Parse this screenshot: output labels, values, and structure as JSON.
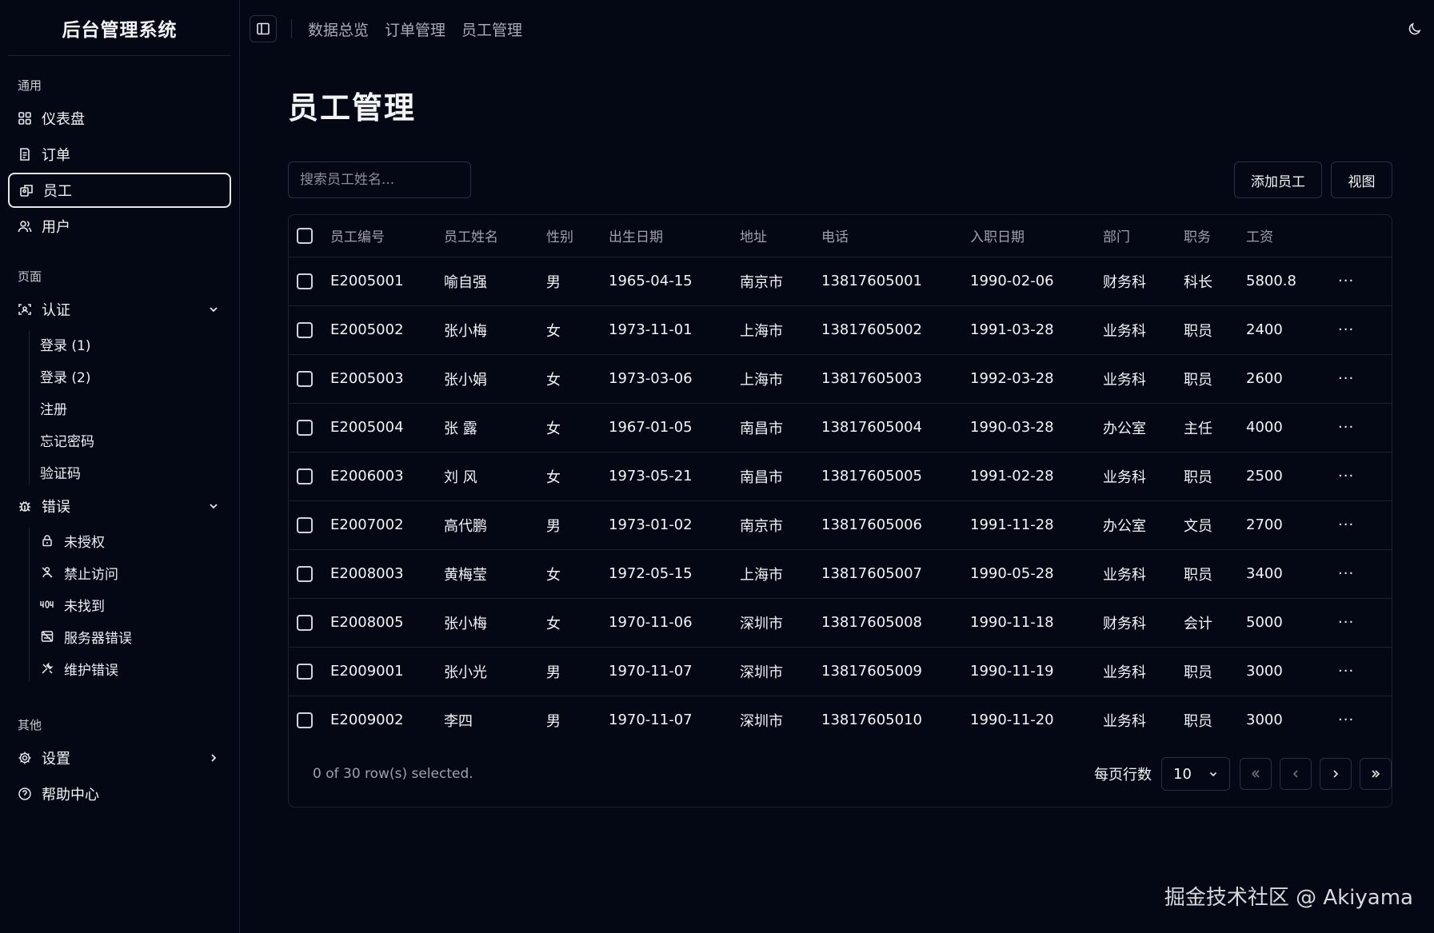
{
  "sidebar": {
    "brand": "后台管理系统",
    "sections": [
      {
        "label": "通用",
        "items": [
          {
            "label": "仪表盘",
            "icon": "dashboard-icon"
          },
          {
            "label": "订单",
            "icon": "order-icon"
          },
          {
            "label": "员工",
            "icon": "employee-icon",
            "active": true
          },
          {
            "label": "用户",
            "icon": "users-icon"
          }
        ]
      },
      {
        "label": "页面",
        "auth": {
          "label": "认证",
          "icon": "auth-icon",
          "children": [
            "登录 (1)",
            "登录 (2)",
            "注册",
            "忘记密码",
            "验证码"
          ]
        },
        "errors": {
          "label": "错误",
          "icon": "bug-icon",
          "children": [
            {
              "label": "未授权",
              "icon": "lock-icon"
            },
            {
              "label": "禁止访问",
              "icon": "forbidden-icon"
            },
            {
              "label": "未找到",
              "icon": "not-found-icon"
            },
            {
              "label": "服务器错误",
              "icon": "server-error-icon"
            },
            {
              "label": "维护错误",
              "icon": "maintenance-icon"
            }
          ]
        }
      },
      {
        "label": "其他",
        "items": [
          {
            "label": "设置",
            "icon": "settings-icon"
          },
          {
            "label": "帮助中心",
            "icon": "help-icon"
          }
        ]
      }
    ]
  },
  "topbar": {
    "links": [
      "数据总览",
      "订单管理",
      "员工管理"
    ]
  },
  "page": {
    "title": "员工管理",
    "search_placeholder": "搜索员工姓名...",
    "add_button": "添加员工",
    "view_button": "视图"
  },
  "table": {
    "columns": [
      "员工编号",
      "员工姓名",
      "性别",
      "出生日期",
      "地址",
      "电话",
      "入职日期",
      "部门",
      "职务",
      "工资"
    ],
    "rows": [
      [
        "E2005001",
        "喻自强",
        "男",
        "1965-04-15",
        "南京市",
        "13817605001",
        "1990-02-06",
        "财务科",
        "科长",
        "5800.8"
      ],
      [
        "E2005002",
        "张小梅",
        "女",
        "1973-11-01",
        "上海市",
        "13817605002",
        "1991-03-28",
        "业务科",
        "职员",
        "2400"
      ],
      [
        "E2005003",
        "张小娟",
        "女",
        "1973-03-06",
        "上海市",
        "13817605003",
        "1992-03-28",
        "业务科",
        "职员",
        "2600"
      ],
      [
        "E2005004",
        "张 露",
        "女",
        "1967-01-05",
        "南昌市",
        "13817605004",
        "1990-03-28",
        "办公室",
        "主任",
        "4000"
      ],
      [
        "E2006003",
        "刘 风",
        "女",
        "1973-05-21",
        "南昌市",
        "13817605005",
        "1991-02-28",
        "业务科",
        "职员",
        "2500"
      ],
      [
        "E2007002",
        "高代鹏",
        "男",
        "1973-01-02",
        "南京市",
        "13817605006",
        "1991-11-28",
        "办公室",
        "文员",
        "2700"
      ],
      [
        "E2008003",
        "黄梅莹",
        "女",
        "1972-05-15",
        "上海市",
        "13817605007",
        "1990-05-28",
        "业务科",
        "职员",
        "3400"
      ],
      [
        "E2008005",
        "张小梅",
        "女",
        "1970-11-06",
        "深圳市",
        "13817605008",
        "1990-11-18",
        "财务科",
        "会计",
        "5000"
      ],
      [
        "E2009001",
        "张小光",
        "男",
        "1970-11-07",
        "深圳市",
        "13817605009",
        "1990-11-19",
        "业务科",
        "职员",
        "3000"
      ],
      [
        "E2009002",
        "李四",
        "男",
        "1970-11-07",
        "深圳市",
        "13817605010",
        "1990-11-20",
        "业务科",
        "职员",
        "3000"
      ]
    ],
    "row_action": "···",
    "selection_text": "0 of 30 row(s) selected.",
    "rows_per_page_label": "每页行数",
    "rows_per_page_value": "10"
  },
  "watermark": "掘金技术社区 @ Akiyama",
  "colors": {
    "background": "#040814",
    "border": "#1c2230",
    "text": "#f3f4f6",
    "muted": "#9ca1ac"
  }
}
